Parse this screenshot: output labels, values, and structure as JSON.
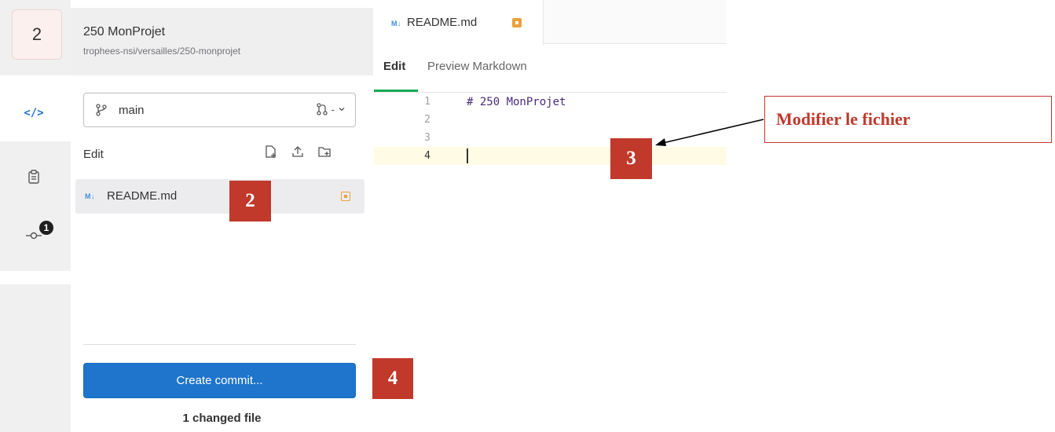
{
  "project": {
    "avatar_letter": "2",
    "name": "250 MonProjet",
    "path": "trophees-nsi/versailles/250-monprojet"
  },
  "branch": {
    "name": "main",
    "mr_label": "-"
  },
  "file_tree": {
    "section_label": "Edit",
    "files": [
      {
        "badge": "M↓",
        "name": "README.md",
        "status": "modified"
      }
    ]
  },
  "editor": {
    "tab": {
      "badge": "M↓",
      "name": "README.md"
    },
    "modes": {
      "edit": "Edit",
      "preview": "Preview Markdown"
    },
    "lines": [
      {
        "num": "1",
        "text": "# 250 MonProjet"
      },
      {
        "num": "2",
        "text": ""
      },
      {
        "num": "3",
        "text": ""
      },
      {
        "num": "4",
        "text": ""
      }
    ]
  },
  "commit": {
    "button_label": "Create commit...",
    "changed_text": "1 changed file"
  },
  "rail": {
    "commit_badge": "1"
  },
  "annotations": {
    "step_2": "2",
    "step_3": "3",
    "step_4": "4",
    "callout_text": "Modifier le fichier"
  },
  "colors": {
    "accent": "#1f75cb",
    "annotation": "#c0392b",
    "modified": "#e9a23b"
  }
}
